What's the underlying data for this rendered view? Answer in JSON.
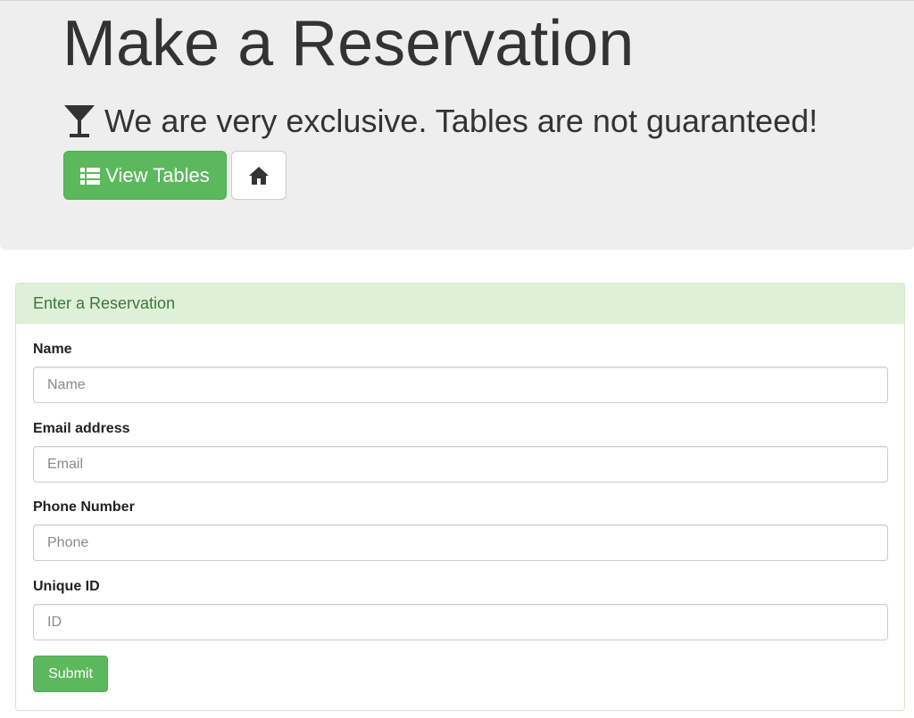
{
  "header": {
    "title": "Make a Reservation",
    "subtitle": "We are very exclusive. Tables are not guaranteed!",
    "icon": "glass-icon"
  },
  "buttons": {
    "view_tables_label": "View Tables",
    "view_tables_icon": "list-icon",
    "home_icon": "home-icon"
  },
  "panel": {
    "heading": "Enter a Reservation"
  },
  "form": {
    "fields": [
      {
        "label": "Name",
        "placeholder": "Name",
        "value": ""
      },
      {
        "label": "Email address",
        "placeholder": "Email",
        "value": ""
      },
      {
        "label": "Phone Number",
        "placeholder": "Phone",
        "value": ""
      },
      {
        "label": "Unique ID",
        "placeholder": "ID",
        "value": ""
      }
    ],
    "submit_label": "Submit"
  },
  "colors": {
    "success": "#5cb85c",
    "jumbotron_bg": "#eeeeee",
    "panel_heading_bg": "#dff0d8",
    "panel_heading_text": "#3c763d"
  }
}
